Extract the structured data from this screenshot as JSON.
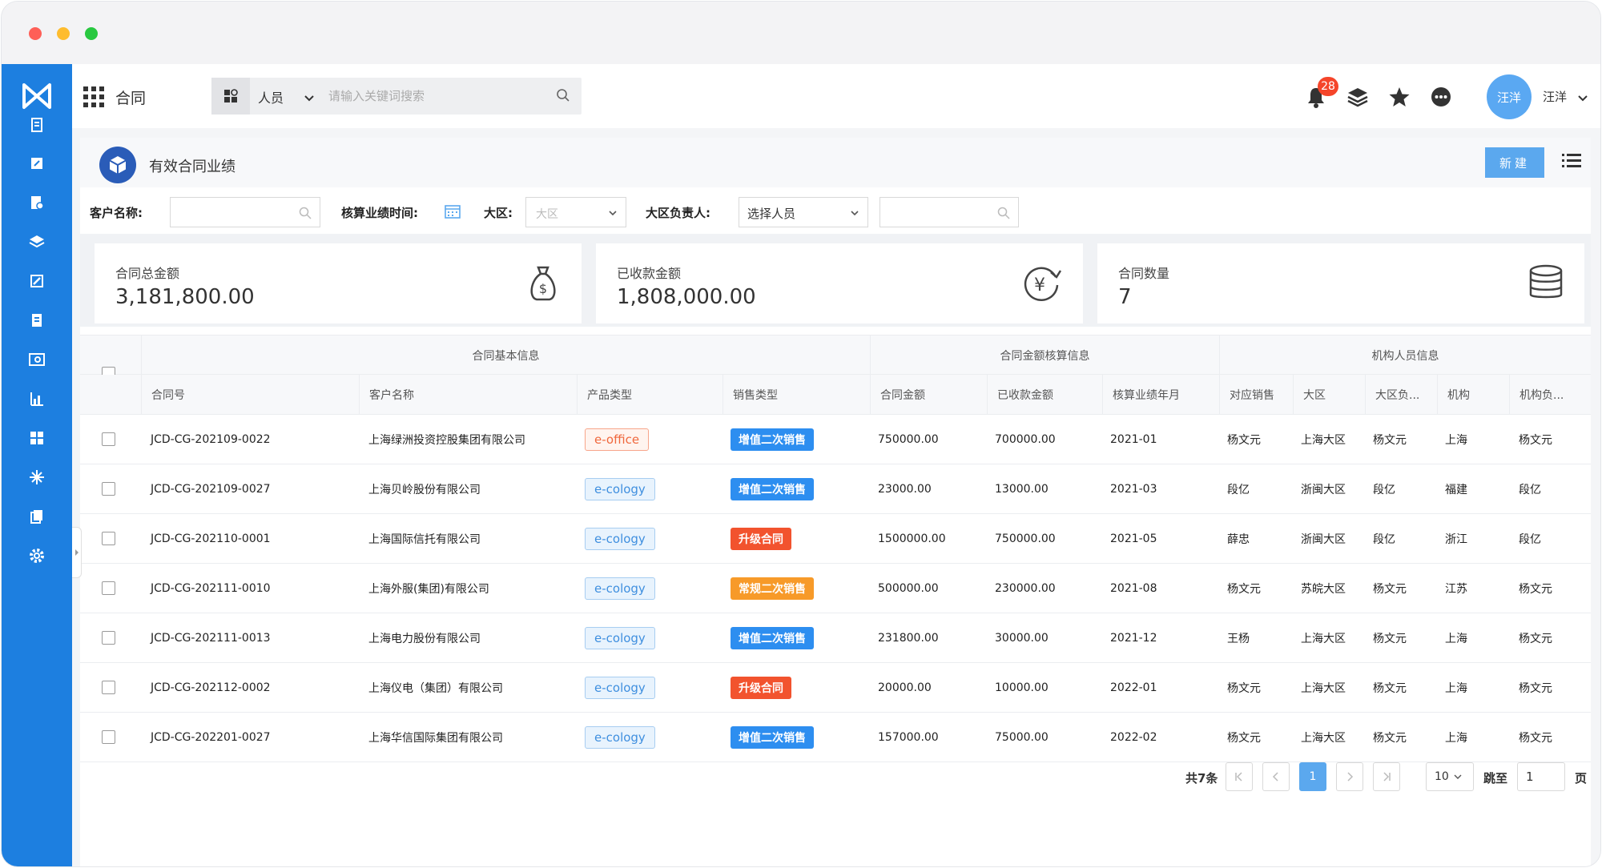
{
  "topbar": {
    "app_title": "合同",
    "search_scope": "人员",
    "search_placeholder": "请输入关键词搜索",
    "notification_count": "28",
    "avatar_text": "汪洋",
    "username": "汪洋"
  },
  "page": {
    "title": "有效合同业绩",
    "new_button": "新建"
  },
  "filters": {
    "customer_label": "客户名称:",
    "time_label": "核算业绩时间:",
    "region_label": "大区:",
    "region_placeholder": "大区",
    "manager_label": "大区负责人:",
    "manager_value": "选择人员"
  },
  "stats": [
    {
      "label": "合同总金额",
      "value": "3,181,800.00",
      "icon": "money-bag-icon"
    },
    {
      "label": "已收款金额",
      "value": "1,808,000.00",
      "icon": "yen-refresh-icon"
    },
    {
      "label": "合同数量",
      "value": "7",
      "icon": "database-icon"
    }
  ],
  "table": {
    "groups": [
      "合同基本信息",
      "合同金额核算信息",
      "机构人员信息"
    ],
    "columns": [
      "合同号",
      "客户名称",
      "产品类型",
      "销售类型",
      "合同金额",
      "已收款金额",
      "核算业绩年月",
      "对应销售",
      "大区",
      "大区负...",
      "机构",
      "机构负..."
    ],
    "rows": [
      {
        "id": "JCD-CG-202109-0022",
        "customer": "上海绿洲投资控股集团有限公司",
        "product": "e-office",
        "sale": "增值二次销售",
        "amount": "750000.00",
        "received": "700000.00",
        "month": "2021-01",
        "sales": "杨文元",
        "region": "上海大区",
        "region_mgr": "杨文元",
        "org": "上海",
        "org_mgr": "杨文元"
      },
      {
        "id": "JCD-CG-202109-0027",
        "customer": "上海贝岭股份有限公司",
        "product": "e-cology",
        "sale": "增值二次销售",
        "amount": "23000.00",
        "received": "13000.00",
        "month": "2021-03",
        "sales": "段亿",
        "region": "浙闽大区",
        "region_mgr": "段亿",
        "org": "福建",
        "org_mgr": "段亿"
      },
      {
        "id": "JCD-CG-202110-0001",
        "customer": "上海国际信托有限公司",
        "product": "e-cology",
        "sale": "升级合同",
        "amount": "1500000.00",
        "received": "750000.00",
        "month": "2021-05",
        "sales": "薛忠",
        "region": "浙闽大区",
        "region_mgr": "段亿",
        "org": "浙江",
        "org_mgr": "段亿"
      },
      {
        "id": "JCD-CG-202111-0010",
        "customer": "上海外服(集团)有限公司",
        "product": "e-cology",
        "sale": "常规二次销售",
        "amount": "500000.00",
        "received": "230000.00",
        "month": "2021-08",
        "sales": "杨文元",
        "region": "苏皖大区",
        "region_mgr": "杨文元",
        "org": "江苏",
        "org_mgr": "杨文元"
      },
      {
        "id": "JCD-CG-202111-0013",
        "customer": "上海电力股份有限公司",
        "product": "e-cology",
        "sale": "增值二次销售",
        "amount": "231800.00",
        "received": "30000.00",
        "month": "2021-12",
        "sales": "王杨",
        "region": "上海大区",
        "region_mgr": "杨文元",
        "org": "上海",
        "org_mgr": "杨文元"
      },
      {
        "id": "JCD-CG-202112-0002",
        "customer": "上海仪电（集团）有限公司",
        "product": "e-cology",
        "sale": "升级合同",
        "amount": "20000.00",
        "received": "10000.00",
        "month": "2022-01",
        "sales": "杨文元",
        "region": "上海大区",
        "region_mgr": "杨文元",
        "org": "上海",
        "org_mgr": "杨文元"
      },
      {
        "id": "JCD-CG-202201-0027",
        "customer": "上海华信国际集团有限公司",
        "product": "e-cology",
        "sale": "增值二次销售",
        "amount": "157000.00",
        "received": "75000.00",
        "month": "2022-02",
        "sales": "杨文元",
        "region": "上海大区",
        "region_mgr": "杨文元",
        "org": "上海",
        "org_mgr": "杨文元"
      }
    ]
  },
  "pagination": {
    "total": "共7条",
    "current_page": "1",
    "page_size": "10",
    "jump_label": "跳至",
    "jump_value": "1",
    "page_suffix": "页"
  },
  "colors": {
    "brand": "#1d7fe0",
    "primary_button": "#5ba8ee",
    "sale_blue": "#2d8ef0",
    "sale_red": "#f2532e",
    "sale_orange": "#f79a29"
  }
}
